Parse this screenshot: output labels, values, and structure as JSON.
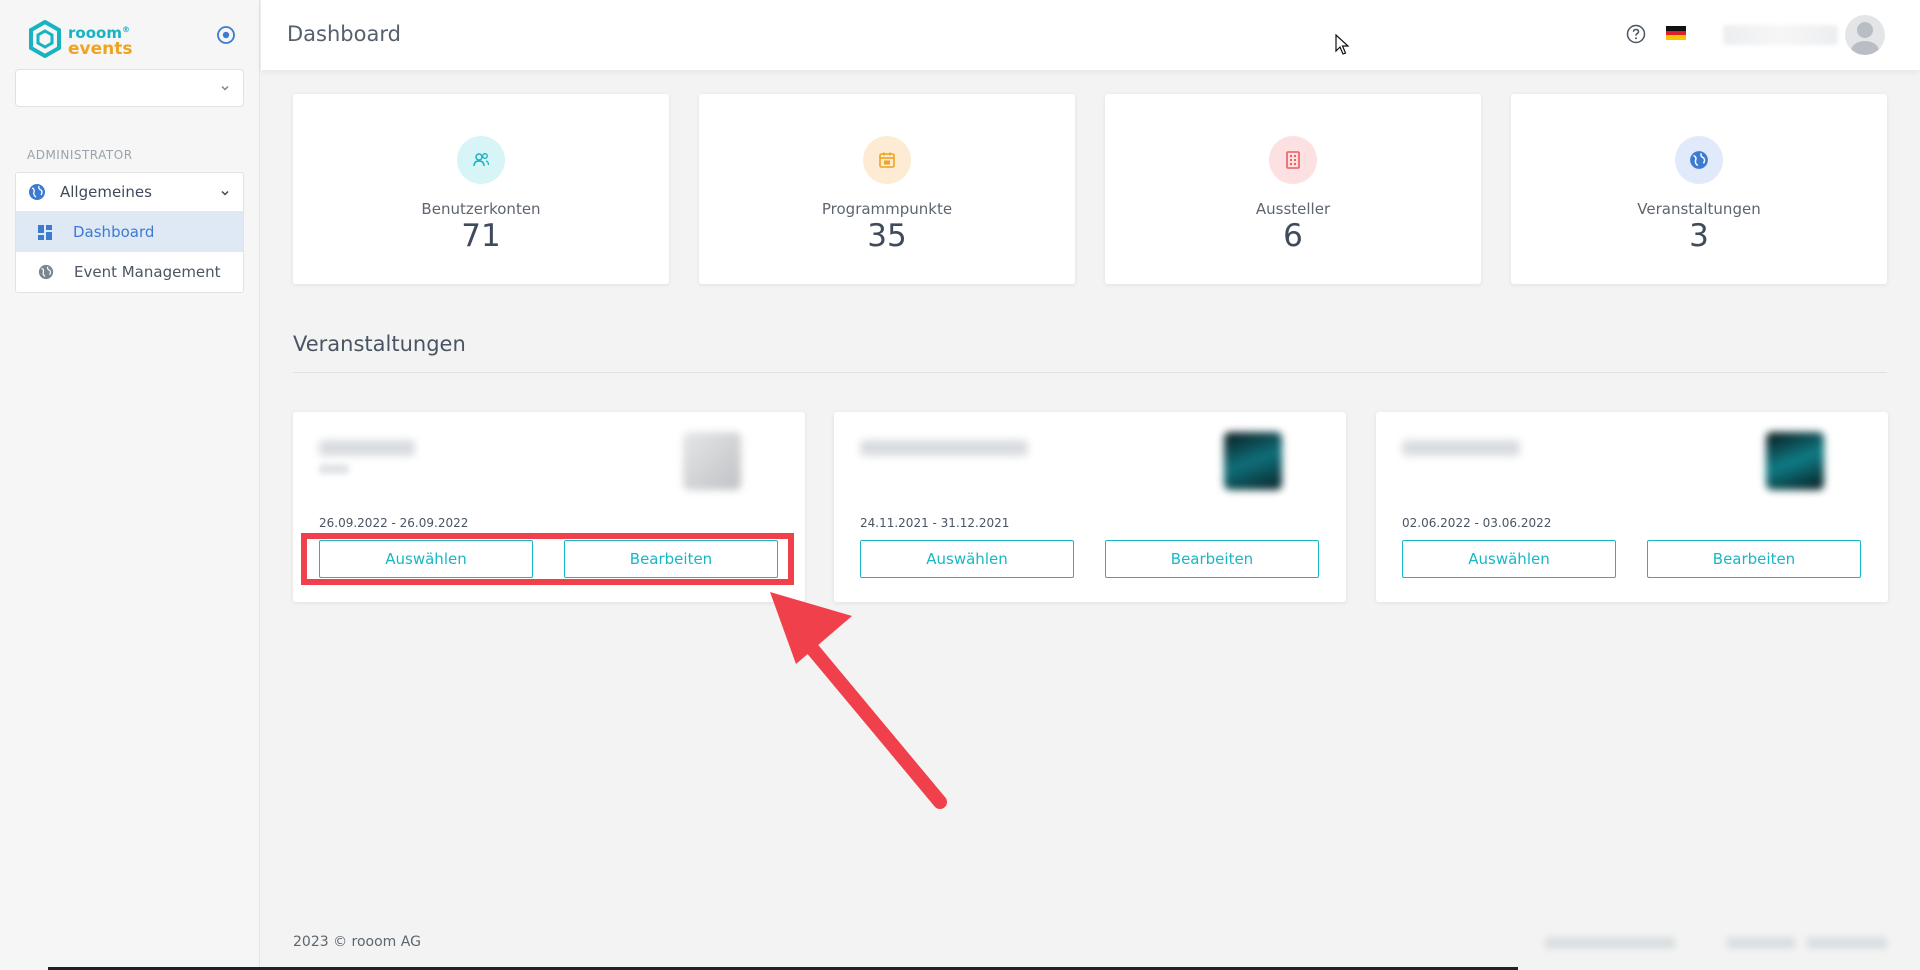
{
  "app": {
    "logo_line1": "rooom",
    "logo_tm": "®",
    "logo_line2": "events"
  },
  "sidebar": {
    "section_label": "ADMINISTRATOR",
    "menu": [
      {
        "label": "Allgemeines",
        "icon": "globe-icon"
      },
      {
        "label": "Dashboard",
        "icon": "dashboard-icon"
      },
      {
        "label": "Event Management",
        "icon": "globe-icon"
      }
    ]
  },
  "header": {
    "title": "Dashboard"
  },
  "stats": [
    {
      "label": "Benutzerkonten",
      "value": "71",
      "icon": "users-icon",
      "color": "#18b3c1",
      "bg": "#d7f4f6"
    },
    {
      "label": "Programmpunkte",
      "value": "35",
      "icon": "calendar-icon",
      "color": "#f0a31e",
      "bg": "#fdebd3"
    },
    {
      "label": "Aussteller",
      "value": "6",
      "icon": "building-icon",
      "color": "#ee5a61",
      "bg": "#fde0e1"
    },
    {
      "label": "Veranstaltungen",
      "value": "3",
      "icon": "globe-icon",
      "color": "#3d7bd1",
      "bg": "#e1eafa"
    }
  ],
  "events_section": {
    "title": "Veranstaltungen"
  },
  "events": [
    {
      "date": "26.09.2022 - 26.09.2022",
      "select_label": "Auswählen",
      "edit_label": "Bearbeiten"
    },
    {
      "date": "24.11.2021 - 31.12.2021",
      "select_label": "Auswählen",
      "edit_label": "Bearbeiten"
    },
    {
      "date": "02.06.2022 - 03.06.2022",
      "select_label": "Auswählen",
      "edit_label": "Bearbeiten"
    }
  ],
  "footer": {
    "copyright": "2023 © rooom AG"
  },
  "colors": {
    "accent": "#19b7c5",
    "highlight": "#f0404b",
    "active_bg": "#dfe9f6"
  }
}
